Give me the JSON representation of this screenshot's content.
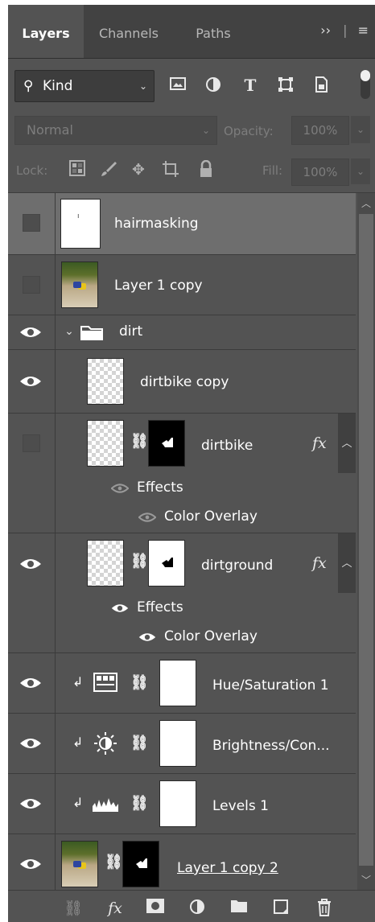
{
  "tabs": [
    {
      "label": "Layers",
      "active": true
    },
    {
      "label": "Channels",
      "active": false
    },
    {
      "label": "Paths",
      "active": false
    }
  ],
  "tab_menu": {
    "expand": "››",
    "menu": "≡"
  },
  "filter": {
    "kind_label": "Kind",
    "icons": [
      "image-filter-icon",
      "adjustment-filter-icon",
      "type-filter-icon",
      "shape-filter-icon",
      "smart-object-filter-icon"
    ]
  },
  "blend": {
    "mode": "Normal",
    "opacity_label": "Opacity:",
    "opacity_value": "100%"
  },
  "lock": {
    "label": "Lock:",
    "fill_label": "Fill:",
    "fill_value": "100%"
  },
  "layers": [
    {
      "name": "hairmasking",
      "visible": false,
      "selected": true
    },
    {
      "name": "Layer 1 copy",
      "visible": false
    },
    {
      "name": "dirt",
      "visible": true,
      "type": "group",
      "expanded": true
    },
    {
      "name": "dirtbike copy",
      "visible": true
    },
    {
      "name": "dirtbike",
      "visible": false,
      "fx": "fx",
      "effects_label": "Effects",
      "effect": "Color Overlay"
    },
    {
      "name": "dirtground",
      "visible": true,
      "fx": "fx",
      "effects_label": "Effects",
      "effect": "Color Overlay"
    },
    {
      "name": "Hue/Saturation 1",
      "visible": true
    },
    {
      "name": "Brightness/Con...",
      "visible": true
    },
    {
      "name": "Levels 1",
      "visible": true
    },
    {
      "name": "Layer 1 copy 2",
      "visible": true
    }
  ],
  "colors": {
    "panel": "#535353",
    "selected": "#6e6e6e",
    "tabbar": "#424242"
  }
}
